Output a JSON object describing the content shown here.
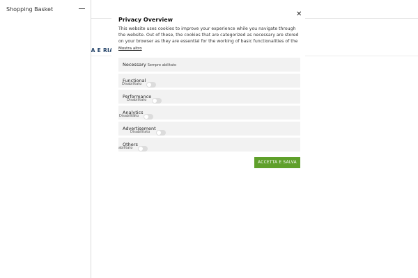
{
  "drawer": {
    "title": "Shopping Basket"
  },
  "background": {
    "menu_fragment": "SPIA E RIAE"
  },
  "modal": {
    "title": "Privacy Overview",
    "description": "This website uses cookies to improve your experience while you navigate through the website. Out of these, the cookies that are categorized as necessary are stored on your browser as they are essential for the working of basic functionalities of the ...",
    "show_more": "Mostra altro",
    "categories": [
      {
        "label": "Necessary",
        "status": "Sempre abilitato"
      },
      {
        "label": "Functional",
        "status": "Disabilitato",
        "enabled": false
      },
      {
        "label": "Performance",
        "status": "Disabilitato",
        "enabled": false
      },
      {
        "label": "Analytics",
        "status": "Disabilitato",
        "enabled": false
      },
      {
        "label": "Advertisement",
        "status": "Disabilitato",
        "enabled": false
      },
      {
        "label": "Others",
        "status": "abilitato",
        "enabled": false
      }
    ],
    "save_button": "ACCETTA E SALVA"
  },
  "colors": {
    "save_button_bg": "#5fa02b",
    "row_bg": "#f2f2f2",
    "menu_text": "#1f3f66"
  }
}
